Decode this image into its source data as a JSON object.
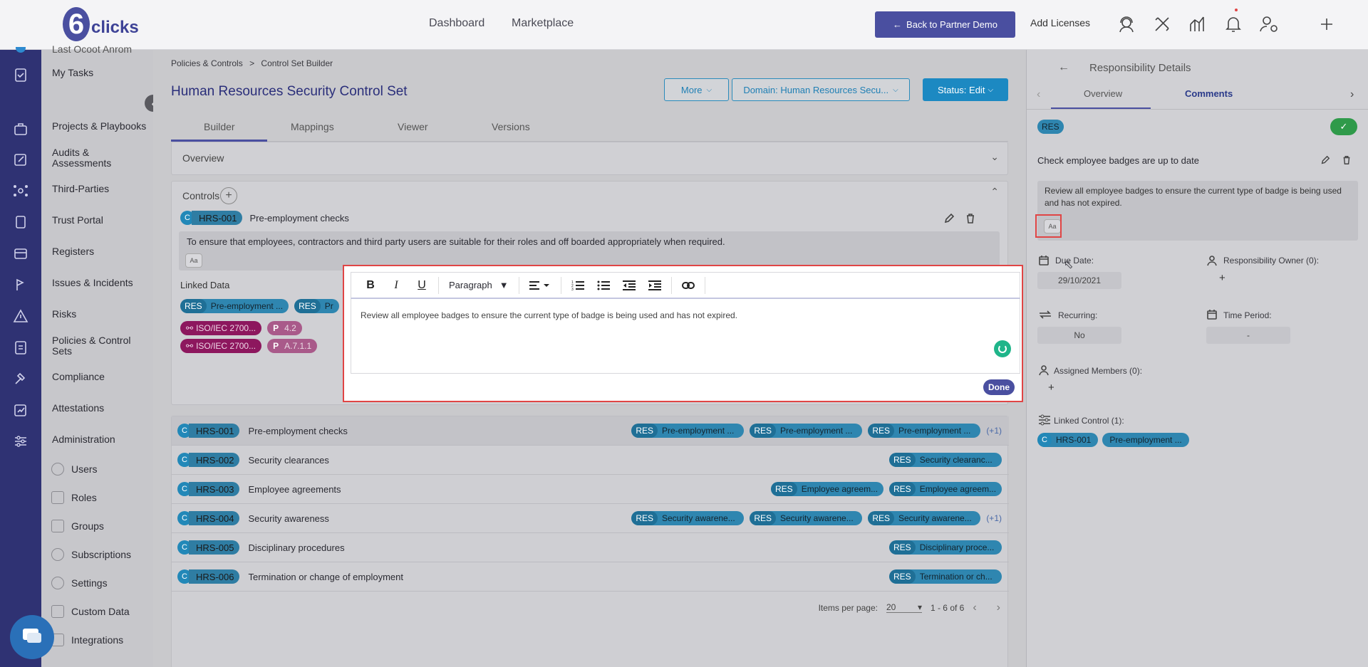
{
  "topbar": {
    "logo_text": "clicks",
    "nav": [
      "Dashboard",
      "Marketplace"
    ],
    "back_button": "Back to Partner Demo",
    "add_licenses": "Add Licenses"
  },
  "sidebar": {
    "partial_item": "Last Ocoot Anrom",
    "items": [
      {
        "label": "My Tasks"
      },
      {
        "label": "Projects & Playbooks"
      },
      {
        "label": "Audits & Assessments"
      },
      {
        "label": "Third-Parties"
      },
      {
        "label": "Trust Portal"
      },
      {
        "label": "Registers"
      },
      {
        "label": "Issues & Incidents"
      },
      {
        "label": "Risks"
      },
      {
        "label": "Policies & Control Sets"
      },
      {
        "label": "Compliance"
      },
      {
        "label": "Attestations"
      },
      {
        "label": "Administration"
      }
    ],
    "sub_items": [
      {
        "label": "Users",
        "icon": "user-icon"
      },
      {
        "label": "Roles",
        "icon": "briefcase-icon"
      },
      {
        "label": "Groups",
        "icon": "groups-icon"
      },
      {
        "label": "Subscriptions",
        "icon": "refresh-icon"
      },
      {
        "label": "Settings",
        "icon": "gear-icon"
      },
      {
        "label": "Custom Data",
        "icon": "database-icon"
      },
      {
        "label": "Integrations",
        "icon": "integrations-icon"
      }
    ]
  },
  "breadcrumb": {
    "parent": "Policies & Controls",
    "sep": ">",
    "current": "Control Set Builder"
  },
  "page": {
    "title": "Human Resources Security Control Set",
    "more": "More",
    "domain": "Domain: Human Resources Secu...",
    "status": "Status: Edit"
  },
  "tabs": [
    "Builder",
    "Mappings",
    "Viewer",
    "Versions"
  ],
  "overview_label": "Overview",
  "controls": {
    "label": "Controls",
    "current": {
      "c": "C",
      "code": "HRS-001",
      "name": "Pre-employment checks",
      "description": "To ensure that employees, contractors and third party users are suitable for their roles and off boarded appropriately when required.",
      "aa": "Aa"
    },
    "linked_data_label": "Linked Data",
    "linked_res": [
      {
        "tag": "RES",
        "text": "Pre-employment ..."
      },
      {
        "tag": "RES",
        "text": "Pr"
      }
    ],
    "iso": [
      {
        "text": "ISO/IEC 2700...",
        "p": "P",
        "val": "4.2"
      },
      {
        "text": "ISO/IEC 2700...",
        "p": "P",
        "val": "A.7.1.1"
      }
    ]
  },
  "rows": [
    {
      "c": "C",
      "code": "HRS-001",
      "name": "Pre-employment checks",
      "chips": [
        "Pre-employment ...",
        "Pre-employment ...",
        "Pre-employment ..."
      ],
      "more": "(+1)"
    },
    {
      "c": "C",
      "code": "HRS-002",
      "name": "Security clearances",
      "chips": [
        "Security clearanc..."
      ],
      "more": ""
    },
    {
      "c": "C",
      "code": "HRS-003",
      "name": "Employee agreements",
      "chips": [
        "Employee agreem...",
        "Employee agreem..."
      ],
      "more": ""
    },
    {
      "c": "C",
      "code": "HRS-004",
      "name": "Security awareness",
      "chips": [
        "Security awarene...",
        "Security awarene...",
        "Security awarene..."
      ],
      "more": "(+1)"
    },
    {
      "c": "C",
      "code": "HRS-005",
      "name": "Disciplinary procedures",
      "chips": [
        "Disciplinary proce..."
      ],
      "more": ""
    },
    {
      "c": "C",
      "code": "HRS-006",
      "name": "Termination or change of employment",
      "chips": [
        "Termination or ch..."
      ],
      "more": ""
    }
  ],
  "res_tag": "RES",
  "pagination": {
    "items_per_page_label": "Items per page:",
    "items_per_page": "20",
    "range": "1 - 6 of 6"
  },
  "editor": {
    "paragraph": "Paragraph",
    "content": "Review all employee badges to ensure the current type of badge is being used and has not expired.",
    "done": "Done"
  },
  "right_panel": {
    "title": "Responsibility Details",
    "tabs": [
      "Overview",
      "Comments"
    ],
    "tag": "RES",
    "name": "Check employee badges are up to date",
    "description": "Review all employee badges to ensure the current type of badge is being used and has not expired.",
    "aa": "Aa",
    "due_date_label": "Due Date:",
    "due_date": "29/10/2021",
    "owner_label": "Responsibility Owner (0):",
    "recurring_label": "Recurring:",
    "recurring": "No",
    "time_period_label": "Time Period:",
    "time_period": "-",
    "assigned_label": "Assigned Members (0):",
    "linked_control_label": "Linked Control (1):",
    "linked_c": "C",
    "linked_code": "HRS-001",
    "linked_name": "Pre-employment ..."
  },
  "colors": {
    "brand": "#4a4fa0",
    "accent": "#1c89c2",
    "highlight": "#e04545",
    "iso": "#a0196a"
  }
}
